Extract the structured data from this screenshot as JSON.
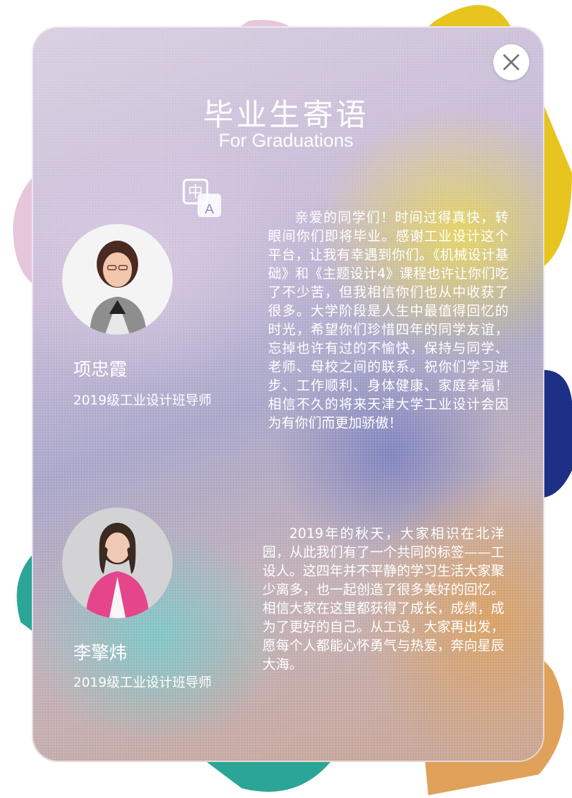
{
  "header": {
    "title": "毕业生寄语",
    "subtitle": "For Graduations"
  },
  "icons": {
    "close": "close-icon",
    "translate": "translate-icon",
    "translate_top_glyph": "中",
    "translate_bottom_glyph": "A"
  },
  "colors": {
    "yellow_blob": "#e8c41f",
    "pink_blob": "#e6c6da",
    "teal_blob": "#2aa596",
    "navy_blob": "#1e2f86",
    "orange_blob": "#e0a15a"
  },
  "teachers": [
    {
      "name": "项忠霞",
      "role": "2019级工业设计班导师",
      "message": "亲爱的同学们！时间过得真快，转眼间你们即将毕业。感谢工业设计这个平台，让我有幸遇到你们。《机械设计基础》和《主题设计4》课程也许让你们吃了不少苦，但我相信你们也从中收获了很多。大学阶段是人生中最值得回忆的时光，希望你们珍惜四年的同学友谊，忘掉也许有过的不愉快，保持与同学、老师、母校之间的联系。祝你们学习进步、工作顺利、身体健康、家庭幸福！相信不久的将来天津大学工业设计会因为有你们而更加骄傲！"
    },
    {
      "name": "李擎炜",
      "role": "2019级工业设计班导师",
      "message": "2019年的秋天，大家相识在北洋园，从此我们有了一个共同的标签——工设人。这四年并不平静的学习生活大家聚少离多，也一起创造了很多美好的回忆。相信大家在这里都获得了成长，成绩，成为了更好的自己。从工设，大家再出发，愿每个人都能心怀勇气与热爱，奔向星辰大海。"
    }
  ]
}
